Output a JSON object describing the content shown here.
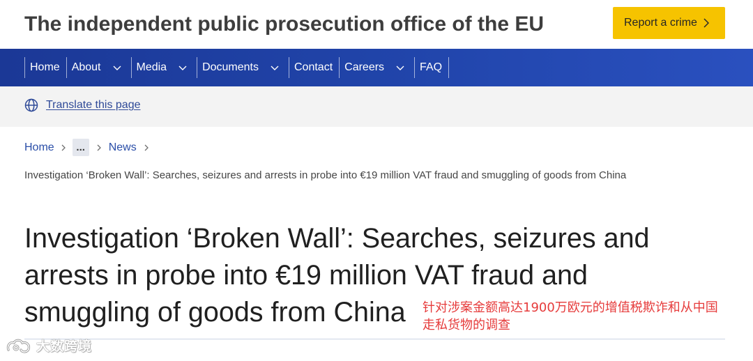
{
  "header": {
    "site_title": "The independent public prosecution office of the EU",
    "report_button": {
      "label": "Report a crime",
      "icon": "chevron-right-icon"
    }
  },
  "nav": {
    "items": [
      {
        "label": "Home",
        "has_dropdown": false
      },
      {
        "label": "About",
        "has_dropdown": true
      },
      {
        "label": "Media",
        "has_dropdown": true
      },
      {
        "label": "Documents",
        "has_dropdown": true
      },
      {
        "label": "Contact",
        "has_dropdown": false
      },
      {
        "label": "Careers",
        "has_dropdown": true
      },
      {
        "label": "FAQ",
        "has_dropdown": false
      }
    ],
    "dropdown_icon": "chevron-down-icon"
  },
  "translate": {
    "label": "Translate this page",
    "icon": "globe-icon"
  },
  "breadcrumb": {
    "items": [
      {
        "label": "Home"
      },
      {
        "label": "News"
      }
    ],
    "collapsed_label": "...",
    "separator_icon": "chevron-right-icon",
    "current": "Investigation ‘Broken Wall’: Searches, seizures and arrests in probe into €19 million VAT fraud and smuggling of goods from China"
  },
  "article": {
    "title": "Investigation ‘Broken Wall’: Searches, seizures and arrests in probe into €19 million VAT fraud and smuggling of goods from China"
  },
  "annotation": {
    "text": "针对涉案金额高达1900万欧元的增值税欺诈和从中国走私货物的调查"
  },
  "watermark": {
    "text": "大数跨境",
    "icon": "logo-icon"
  },
  "colors": {
    "nav_background": "#1f3fa3",
    "report_button": "#f6c300",
    "link": "#2a4ea8",
    "translate_link": "#2f4a98",
    "translate_bar": "#f3f3f3",
    "annotation": "#e63b3b",
    "title_text": "#3d3d3d"
  }
}
